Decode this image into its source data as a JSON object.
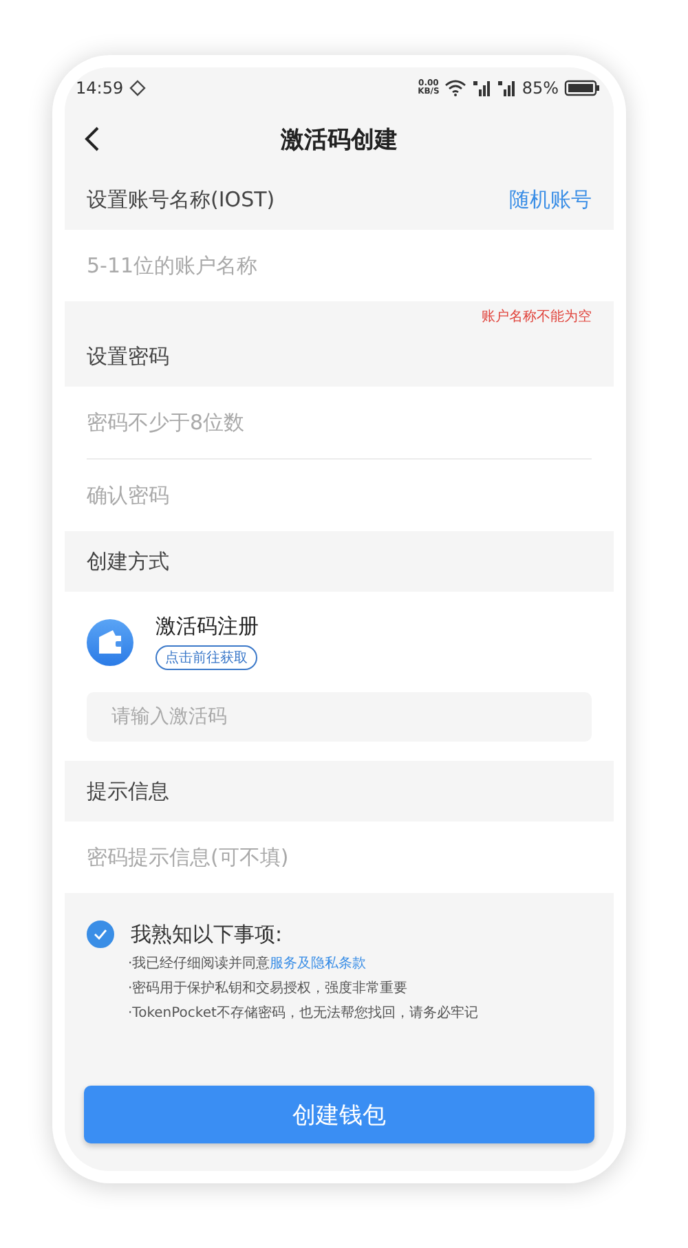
{
  "status_bar": {
    "time": "14:59",
    "net_speed": "0.00",
    "net_unit": "KB/S",
    "battery": "85%"
  },
  "header": {
    "title": "激活码创建"
  },
  "account": {
    "label": "设置账号名称(IOST)",
    "action": "随机账号",
    "placeholder": "5-11位的账户名称",
    "error": "账户名称不能为空"
  },
  "password": {
    "label": "设置密码",
    "fields": [
      {
        "placeholder": "密码不少于8位数"
      },
      {
        "placeholder": "确认密码"
      }
    ]
  },
  "method": {
    "label": "创建方式",
    "name": "激活码注册",
    "link": "点击前往获取",
    "code_placeholder": "请输入激活码"
  },
  "hint": {
    "label": "提示信息",
    "placeholder": "密码提示信息(可不填)"
  },
  "terms": {
    "checked": true,
    "title": "我熟知以下事项:",
    "items": [
      {
        "text": "·我已经仔细阅读并同意",
        "link": "服务及隐私条款"
      },
      {
        "text": "·密码用于保护私钥和交易授权，强度非常重要"
      },
      {
        "text": "·TokenPocket不存储密码，也无法帮您找回，请务必牢记"
      }
    ]
  },
  "submit": {
    "label": "创建钱包"
  }
}
